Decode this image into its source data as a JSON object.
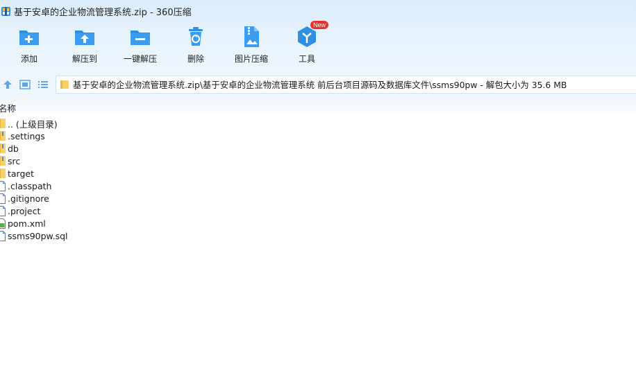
{
  "window": {
    "title": "基于安卓的企业物流管理系统.zip - 360压缩"
  },
  "toolbar": {
    "items": [
      {
        "label": "添加",
        "icon": "add-icon"
      },
      {
        "label": "解压到",
        "icon": "extract-to-icon"
      },
      {
        "label": "一键解压",
        "icon": "one-click-extract-icon"
      },
      {
        "label": "删除",
        "icon": "delete-icon"
      },
      {
        "label": "图片压缩",
        "icon": "image-compress-icon"
      },
      {
        "label": "工具",
        "icon": "tools-icon",
        "badge": "New"
      }
    ]
  },
  "address": {
    "path": "基于安卓的企业物流管理系统.zip\\基于安卓的企业物流管理系统 前后台项目源码及数据库文件\\ssms90pw - 解包大小为 35.6 MB"
  },
  "columns": {
    "name": "名称"
  },
  "files": [
    {
      "name": ".. (上级目录)",
      "type": "folder"
    },
    {
      "name": ".settings",
      "type": "folder"
    },
    {
      "name": "db",
      "type": "folder"
    },
    {
      "name": "src",
      "type": "folder"
    },
    {
      "name": "target",
      "type": "folder"
    },
    {
      "name": ".classpath",
      "type": "file"
    },
    {
      "name": ".gitignore",
      "type": "file"
    },
    {
      "name": ".project",
      "type": "file"
    },
    {
      "name": "pom.xml",
      "type": "xml"
    },
    {
      "name": "ssms90pw.sql",
      "type": "file"
    }
  ],
  "colors": {
    "accent": "#2f8fe0",
    "background": "#dbecfb",
    "folder": "#f7d06a"
  }
}
